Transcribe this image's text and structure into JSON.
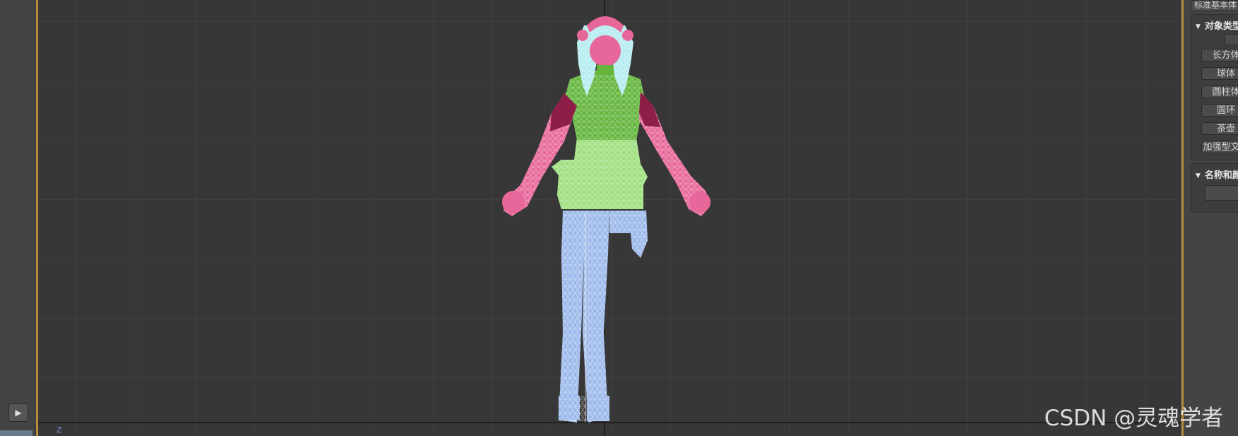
{
  "app": {
    "watermark": "CSDN @灵魂学者",
    "colors": {
      "viewport_bg": "#373737",
      "active_border": "#b78d3c",
      "grid_minor": "#444444",
      "grid_major": "#1e1e1e",
      "mesh_head": "#e8679a",
      "mesh_hair": "#b6ecf0",
      "mesh_torso": "#63b53c",
      "mesh_skirt": "#9ee07f",
      "mesh_legs": "#9bb8ea",
      "mesh_sleeve": "#8c1e47"
    }
  },
  "viewport": {
    "axis_label": "Z"
  },
  "timeline": {
    "play_icon": "play-icon"
  },
  "command_panel": {
    "category_dropdown": "标准基本体",
    "object_type_rollout": {
      "title": "对象类型",
      "buttons": [
        "长方体",
        "球体",
        "圆柱体",
        "圆环",
        "茶壶",
        "加强型文本"
      ]
    },
    "name_color_rollout": {
      "title": "名称和颜色"
    }
  }
}
